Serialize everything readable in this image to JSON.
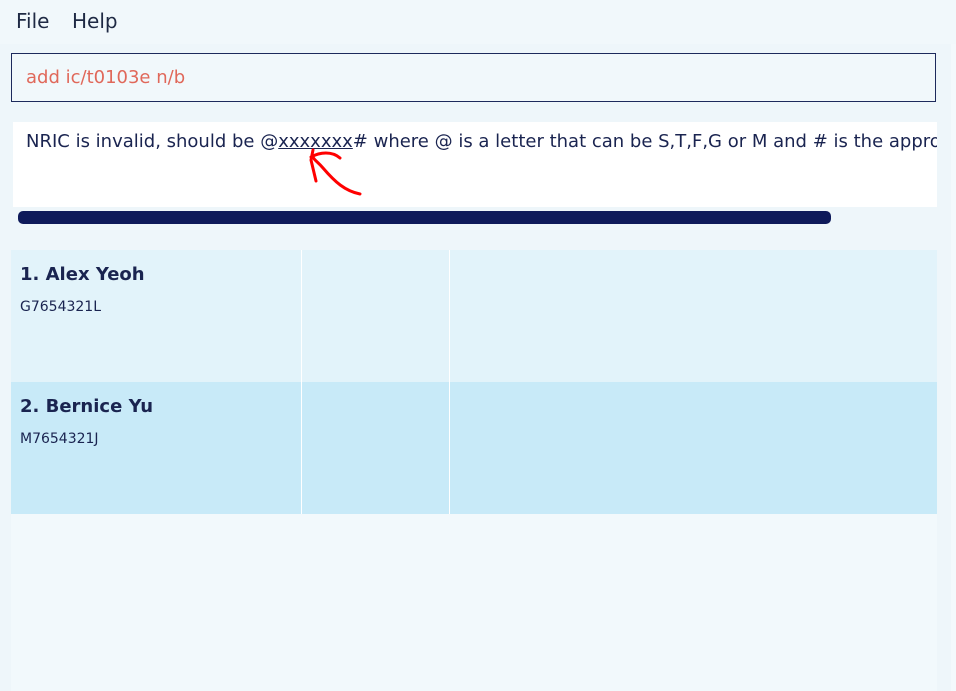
{
  "menubar": {
    "items": [
      {
        "label": "File"
      },
      {
        "label": "Help"
      }
    ]
  },
  "command_box": {
    "value": "add ic/t0103e n/b"
  },
  "result_display": {
    "message_prefix": "NRIC is invalid, should be @",
    "message_underlined": "xxxxxxx",
    "message_suffix": "# where @ is a letter that can be S,T,F,G or M and # is the approp"
  },
  "persons": [
    {
      "index_name": "1. Alex Yeoh",
      "nric": "G7654321L"
    },
    {
      "index_name": "2. Bernice Yu",
      "nric": "M7654321J"
    }
  ],
  "colors": {
    "accent_navy": "#0e1a5a",
    "command_text": "#e0685a",
    "annotation_red": "#ff0000"
  }
}
